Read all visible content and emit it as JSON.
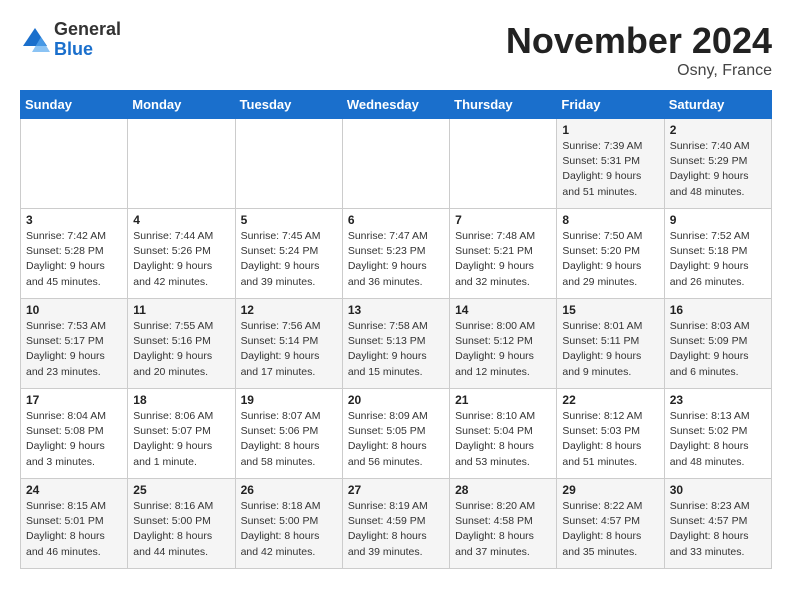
{
  "header": {
    "logo": {
      "general": "General",
      "blue": "Blue"
    },
    "title": "November 2024",
    "location": "Osny, France"
  },
  "weekdays": [
    "Sunday",
    "Monday",
    "Tuesday",
    "Wednesday",
    "Thursday",
    "Friday",
    "Saturday"
  ],
  "weeks": [
    [
      {
        "day": "",
        "info": ""
      },
      {
        "day": "",
        "info": ""
      },
      {
        "day": "",
        "info": ""
      },
      {
        "day": "",
        "info": ""
      },
      {
        "day": "",
        "info": ""
      },
      {
        "day": "1",
        "info": "Sunrise: 7:39 AM\nSunset: 5:31 PM\nDaylight: 9 hours\nand 51 minutes."
      },
      {
        "day": "2",
        "info": "Sunrise: 7:40 AM\nSunset: 5:29 PM\nDaylight: 9 hours\nand 48 minutes."
      }
    ],
    [
      {
        "day": "3",
        "info": "Sunrise: 7:42 AM\nSunset: 5:28 PM\nDaylight: 9 hours\nand 45 minutes."
      },
      {
        "day": "4",
        "info": "Sunrise: 7:44 AM\nSunset: 5:26 PM\nDaylight: 9 hours\nand 42 minutes."
      },
      {
        "day": "5",
        "info": "Sunrise: 7:45 AM\nSunset: 5:24 PM\nDaylight: 9 hours\nand 39 minutes."
      },
      {
        "day": "6",
        "info": "Sunrise: 7:47 AM\nSunset: 5:23 PM\nDaylight: 9 hours\nand 36 minutes."
      },
      {
        "day": "7",
        "info": "Sunrise: 7:48 AM\nSunset: 5:21 PM\nDaylight: 9 hours\nand 32 minutes."
      },
      {
        "day": "8",
        "info": "Sunrise: 7:50 AM\nSunset: 5:20 PM\nDaylight: 9 hours\nand 29 minutes."
      },
      {
        "day": "9",
        "info": "Sunrise: 7:52 AM\nSunset: 5:18 PM\nDaylight: 9 hours\nand 26 minutes."
      }
    ],
    [
      {
        "day": "10",
        "info": "Sunrise: 7:53 AM\nSunset: 5:17 PM\nDaylight: 9 hours\nand 23 minutes."
      },
      {
        "day": "11",
        "info": "Sunrise: 7:55 AM\nSunset: 5:16 PM\nDaylight: 9 hours\nand 20 minutes."
      },
      {
        "day": "12",
        "info": "Sunrise: 7:56 AM\nSunset: 5:14 PM\nDaylight: 9 hours\nand 17 minutes."
      },
      {
        "day": "13",
        "info": "Sunrise: 7:58 AM\nSunset: 5:13 PM\nDaylight: 9 hours\nand 15 minutes."
      },
      {
        "day": "14",
        "info": "Sunrise: 8:00 AM\nSunset: 5:12 PM\nDaylight: 9 hours\nand 12 minutes."
      },
      {
        "day": "15",
        "info": "Sunrise: 8:01 AM\nSunset: 5:11 PM\nDaylight: 9 hours\nand 9 minutes."
      },
      {
        "day": "16",
        "info": "Sunrise: 8:03 AM\nSunset: 5:09 PM\nDaylight: 9 hours\nand 6 minutes."
      }
    ],
    [
      {
        "day": "17",
        "info": "Sunrise: 8:04 AM\nSunset: 5:08 PM\nDaylight: 9 hours\nand 3 minutes."
      },
      {
        "day": "18",
        "info": "Sunrise: 8:06 AM\nSunset: 5:07 PM\nDaylight: 9 hours\nand 1 minute."
      },
      {
        "day": "19",
        "info": "Sunrise: 8:07 AM\nSunset: 5:06 PM\nDaylight: 8 hours\nand 58 minutes."
      },
      {
        "day": "20",
        "info": "Sunrise: 8:09 AM\nSunset: 5:05 PM\nDaylight: 8 hours\nand 56 minutes."
      },
      {
        "day": "21",
        "info": "Sunrise: 8:10 AM\nSunset: 5:04 PM\nDaylight: 8 hours\nand 53 minutes."
      },
      {
        "day": "22",
        "info": "Sunrise: 8:12 AM\nSunset: 5:03 PM\nDaylight: 8 hours\nand 51 minutes."
      },
      {
        "day": "23",
        "info": "Sunrise: 8:13 AM\nSunset: 5:02 PM\nDaylight: 8 hours\nand 48 minutes."
      }
    ],
    [
      {
        "day": "24",
        "info": "Sunrise: 8:15 AM\nSunset: 5:01 PM\nDaylight: 8 hours\nand 46 minutes."
      },
      {
        "day": "25",
        "info": "Sunrise: 8:16 AM\nSunset: 5:00 PM\nDaylight: 8 hours\nand 44 minutes."
      },
      {
        "day": "26",
        "info": "Sunrise: 8:18 AM\nSunset: 5:00 PM\nDaylight: 8 hours\nand 42 minutes."
      },
      {
        "day": "27",
        "info": "Sunrise: 8:19 AM\nSunset: 4:59 PM\nDaylight: 8 hours\nand 39 minutes."
      },
      {
        "day": "28",
        "info": "Sunrise: 8:20 AM\nSunset: 4:58 PM\nDaylight: 8 hours\nand 37 minutes."
      },
      {
        "day": "29",
        "info": "Sunrise: 8:22 AM\nSunset: 4:57 PM\nDaylight: 8 hours\nand 35 minutes."
      },
      {
        "day": "30",
        "info": "Sunrise: 8:23 AM\nSunset: 4:57 PM\nDaylight: 8 hours\nand 33 minutes."
      }
    ]
  ]
}
